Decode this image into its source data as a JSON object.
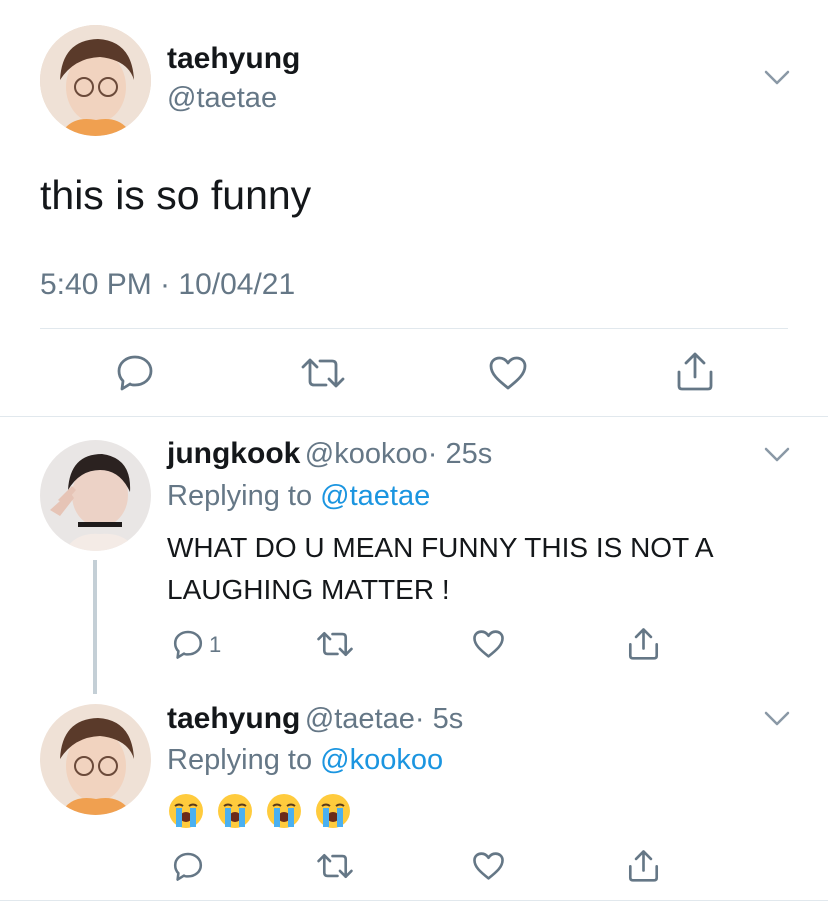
{
  "main_tweet": {
    "author_name": "taehyung",
    "author_handle": "@taetae",
    "text": "this is so funny",
    "timestamp": "5:40 PM · 10/04/21",
    "actions": [
      "reply-icon",
      "retweet-icon",
      "like-icon",
      "share-icon"
    ]
  },
  "replies": [
    {
      "author_name": "jungkook",
      "author_handle": "@kookoo",
      "time": "· 25s",
      "replying_prefix": "Replying to",
      "replying_to": "@taetae",
      "text_line1": "WHAT DO U MEAN FUNNY THIS IS NOT A",
      "text_line2": "LAUGHING MATTER !",
      "reply_count": "1"
    },
    {
      "author_name": "taehyung",
      "author_handle": "@taetae",
      "time": "· 5s",
      "replying_prefix": "Replying to",
      "replying_to": "@kookoo",
      "emoji_count": 4,
      "emoji_name": "loudly-crying-face"
    }
  ],
  "colors": {
    "accent": "#1b95e0",
    "secondary_text": "#657786",
    "icon": "#657786",
    "divider": "#e1e8ed"
  }
}
